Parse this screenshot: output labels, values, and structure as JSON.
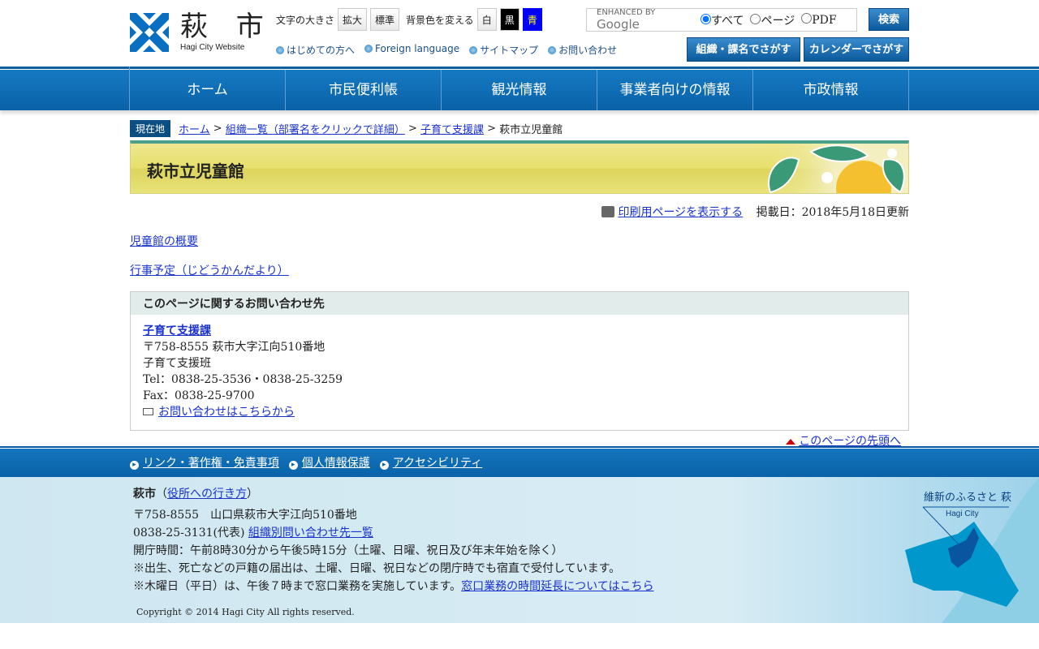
{
  "header": {
    "logo_kanji": "萩 市",
    "logo_en": "Hagi City Website",
    "font_size_label": "文字の大きさ",
    "enlarge": "拡大",
    "standard": "標準",
    "bg_label": "背景色を変える",
    "bg_white": "白",
    "bg_black": "黒",
    "bg_blue": "青",
    "sub_links": [
      "はじめての方へ",
      "Foreign language",
      "サイトマップ",
      "お問い合わせ"
    ],
    "search": {
      "enhanced": "ENHANCED BY",
      "google": "Google",
      "radio_all": "すべて",
      "radio_page": "ページ",
      "radio_pdf": "PDF",
      "button": "検索"
    },
    "org_search": "組織・課名でさがす",
    "calendar_search": "カレンダーでさがす"
  },
  "nav": [
    "ホーム",
    "市民便利帳",
    "観光情報",
    "事業者向けの情報",
    "市政情報"
  ],
  "breadcrumb": {
    "label": "現在地",
    "items": [
      "ホーム",
      "組織一覧（部署名をクリックで詳細）",
      "子育て支援課"
    ],
    "current": "萩市立児童館"
  },
  "page": {
    "title": "萩市立児童館",
    "print": "印刷用ページを表示する",
    "updated": "掲載日：2018年5月18日更新",
    "links": [
      "児童館の概要",
      "行事予定（じどうかんだより）"
    ]
  },
  "contact": {
    "heading": "このページに関するお問い合わせ先",
    "dept": "子育て支援課",
    "address": "〒758-8555 萩市大字江向510番地",
    "section": "子育て支援班",
    "tel": "Tel：0838-25-3536・0838-25-3259",
    "fax": "Fax：0838-25-9700",
    "form": "お問い合わせはこちらから"
  },
  "totop": "このページの先頭へ",
  "footer": {
    "links": [
      "リンク・著作権・免責事項",
      "個人情報保護",
      "アクセシビリティ"
    ],
    "name": "萩市",
    "directions": "役所への行き方",
    "address": "〒758-8555　山口県萩市大字江向510番地",
    "phone": "0838-25-3131(代表)",
    "phone_link": "組織別問い合わせ先一覧",
    "hours": "開庁時間：午前8時30分から午後5時15分（土曜、日曜、祝日及び年末年始を除く）",
    "note1": "※出生、死亡などの戸籍の届出は、土曜、日曜、祝日などの閉庁時でも宿直で受付しています。",
    "note2": "※木曜日（平日）は、午後７時まで窓口業務を実施しています。",
    "note2_link": "窓口業務の時間延長についてはこちら",
    "copyright": "Copyright © 2014 Hagi City All rights reserved.",
    "map_title": "維新のふるさと 萩",
    "map_sub": "Hagi City"
  }
}
